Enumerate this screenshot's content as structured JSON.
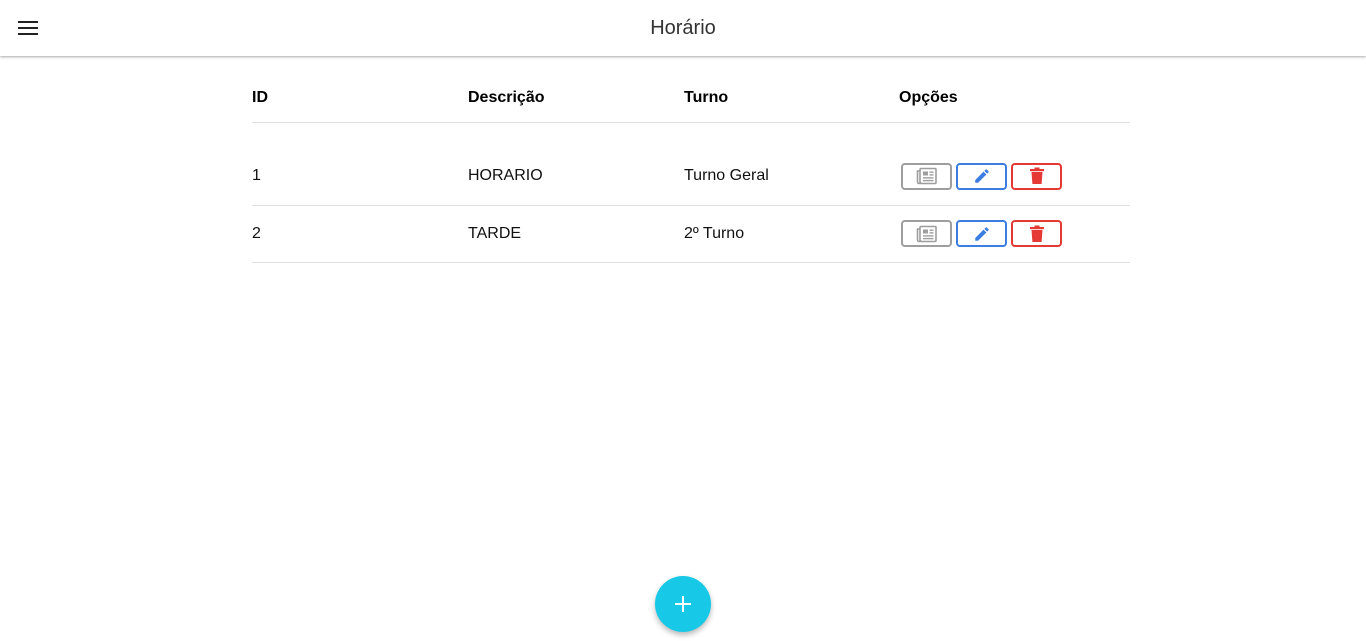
{
  "appbar": {
    "title": "Horário",
    "menu_icon": "menu-icon"
  },
  "table": {
    "headers": {
      "id": "ID",
      "descricao": "Descrição",
      "turno": "Turno",
      "opcoes": "Opções"
    },
    "rows": [
      {
        "id": "1",
        "descricao": "HORARIO",
        "turno": "Turno Geral"
      },
      {
        "id": "2",
        "descricao": "TARDE",
        "turno": "2º Turno"
      }
    ]
  },
  "actions": {
    "view_icon": "newspaper-icon",
    "edit_icon": "pencil-icon",
    "delete_icon": "trash-icon"
  },
  "fab": {
    "icon": "plus-icon"
  },
  "colors": {
    "view": "#9e9e9e",
    "edit": "#3b7de0",
    "delete": "#e53935",
    "fab": "#17c9e6"
  }
}
